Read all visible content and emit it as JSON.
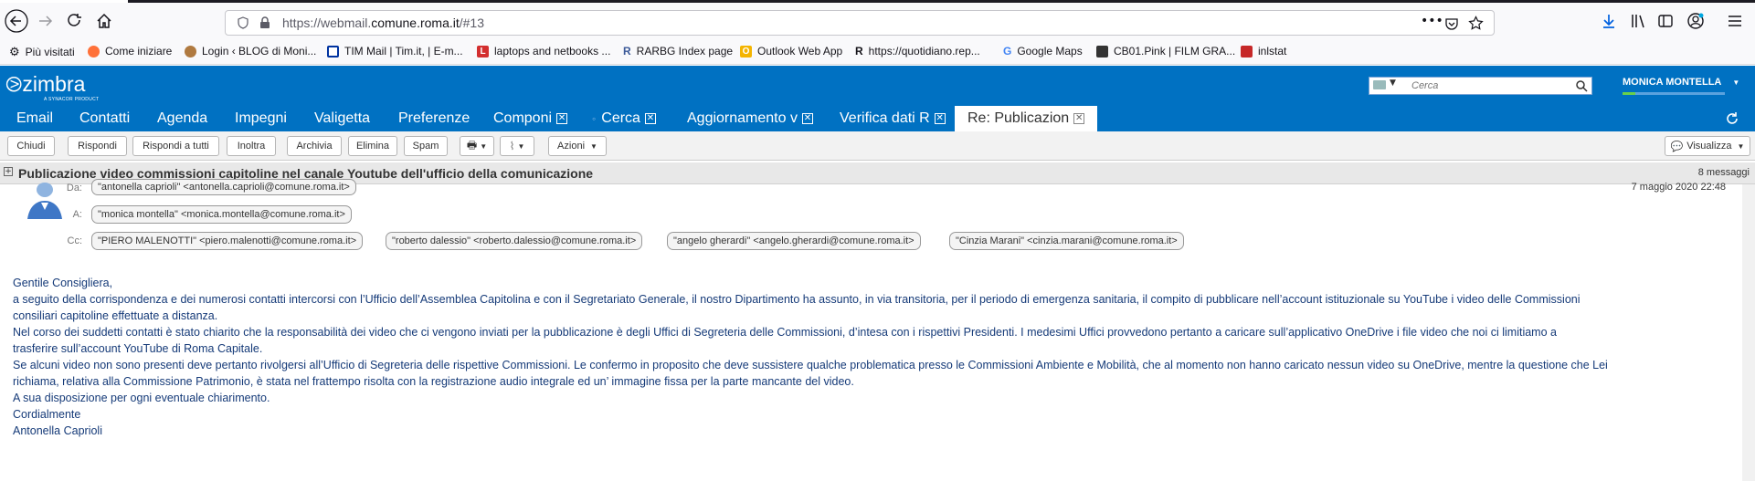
{
  "browser": {
    "url_prefix": "https://webmail.",
    "url_domain": "comune.roma.it",
    "url_suffix": "/#13",
    "bookmarks": [
      {
        "label": "Più visitati",
        "color": "#666"
      },
      {
        "label": "Come iniziare",
        "color": "#ff7139"
      },
      {
        "label": "Login ‹ BLOG di Moni...",
        "color": "#b07a40"
      },
      {
        "label": "TIM Mail | Tim.it, | E-m...",
        "color": "#0033a0"
      },
      {
        "label": "laptops and netbooks ...",
        "color": "#d32f2f"
      },
      {
        "label": "RARBG Index page",
        "color": "#3b5998"
      },
      {
        "label": "Outlook Web App",
        "color": "#f4b400"
      },
      {
        "label": "https://quotidiano.rep...",
        "color": "#222"
      },
      {
        "label": "Google Maps",
        "color": "#4285f4"
      },
      {
        "label": "CB01.Pink | FILM GRA...",
        "color": "#333"
      },
      {
        "label": "inlstat",
        "color": "#c62828"
      }
    ]
  },
  "zimbra": {
    "logo": "zimbra",
    "logo_sub": "A SYNACOR PRODUCT",
    "search_placeholder": "Cerca",
    "user": "MONICA MONTELLA",
    "tabs": [
      {
        "label": "Email",
        "closable": false,
        "active": false
      },
      {
        "label": "Contatti",
        "closable": false,
        "active": false
      },
      {
        "label": "Agenda",
        "closable": false,
        "active": false
      },
      {
        "label": "Impegni",
        "closable": false,
        "active": false
      },
      {
        "label": "Valigetta",
        "closable": false,
        "active": false
      },
      {
        "label": "Preferenze",
        "closable": false,
        "active": false
      },
      {
        "label": "Componi",
        "closable": true,
        "active": false
      },
      {
        "label": "Cerca",
        "closable": true,
        "active": false
      },
      {
        "label": "Aggiornamento v",
        "closable": true,
        "active": false
      },
      {
        "label": "Verifica dati R",
        "closable": true,
        "active": false
      },
      {
        "label": "Re: Publicazion",
        "closable": true,
        "active": true
      }
    ],
    "toolbar": {
      "chiudi": "Chiudi",
      "rispondi": "Rispondi",
      "rispondi_tutti": "Rispondi a tutti",
      "inoltra": "Inoltra",
      "archivia": "Archivia",
      "elimina": "Elimina",
      "spam": "Spam",
      "azioni": "Azioni",
      "visualizza": "Visualizza"
    }
  },
  "message": {
    "subject": "Publicazione video commissioni capitoline nel canale Youtube dell'ufficio della comunicazione",
    "count": "8 messaggi",
    "labels": {
      "da": "Da:",
      "a": "A:",
      "cc": "Cc:"
    },
    "from": "\"antonella caprioli\" <antonella.caprioli@comune.roma.it>",
    "to": "\"monica montella\" <monica.montella@comune.roma.it>",
    "cc": [
      "\"PIERO MALENOTTI\" <piero.malenotti@comune.roma.it>",
      "\"roberto dalessio\" <roberto.dalessio@comune.roma.it>",
      "\"angelo gherardi\" <angelo.gherardi@comune.roma.it>",
      "\"Cinzia Marani\" <cinzia.marani@comune.roma.it>"
    ],
    "date": "7 maggio 2020 22:48",
    "body": [
      "Gentile Consigliera,",
      "a seguito della corrispondenza e dei numerosi contatti intercorsi con l’Ufficio dell’Assemblea Capitolina e con il Segretariato Generale, il nostro Dipartimento ha assunto, in via transitoria, per il periodo di emergenza sanitaria, il compito di pubblicare nell’account istituzionale su YouTube i video delle Commissioni",
      "consiliari capitoline effettuate a distanza.",
      "Nel corso dei suddetti contatti è stato chiarito che la responsabilità dei video che ci vengono inviati per la pubblicazione è degli Uffici di Segreteria delle Commissioni, d’intesa con i rispettivi Presidenti. I medesimi Uffici provvedono pertanto a caricare sull’applicativo OneDrive i file video che noi ci limitiamo a",
      "trasferire sull’account YouTube di Roma Capitale.",
      "Se alcuni video non sono presenti deve pertanto rivolgersi all’Ufficio di Segreteria delle rispettive Commissioni. Le confermo in proposito che deve sussistere qualche problematica presso le Commissioni Ambiente e Mobilità, che al momento non hanno caricato nessun video su OneDrive, mentre la questione che Lei",
      "richiama, relativa alla Commissione Patrimonio, è stata nel frattempo risolta con la registrazione audio integrale ed un’ immagine fissa per la parte mancante del video.",
      "A sua disposizione per ogni eventuale chiarimento.",
      "Cordialmente",
      "Antonella Caprioli"
    ]
  }
}
